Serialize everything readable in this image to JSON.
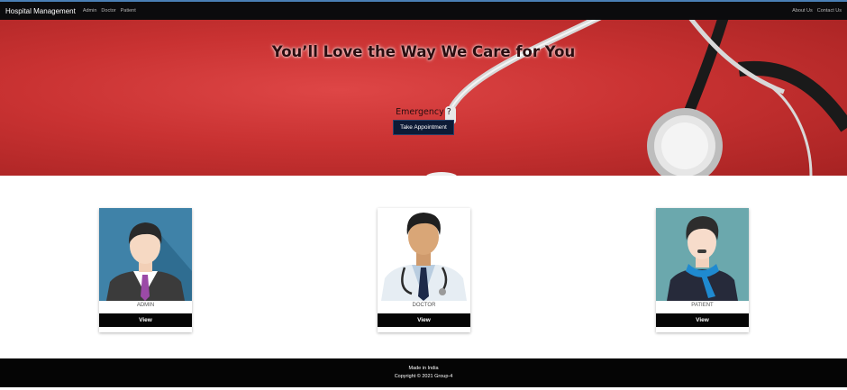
{
  "navbar": {
    "brand": "Hospital Management",
    "links": [
      "Admin",
      "Doctor",
      "Patient"
    ],
    "right_links": [
      "About Us",
      "Contact Us"
    ]
  },
  "hero": {
    "title": "You’ll Love the Way We Care for You",
    "emergency": "Emergency ?",
    "button": "Take Appointment",
    "background_image": "red background with stethoscope"
  },
  "cards": [
    {
      "label": "ADMIN",
      "button": "View",
      "image": "admin avatar illustration"
    },
    {
      "label": "DOCTOR",
      "button": "View",
      "image": "doctor avatar illustration"
    },
    {
      "label": "PATIENT",
      "button": "View",
      "image": "patient avatar illustration"
    }
  ],
  "footer": {
    "line1": "Made in India",
    "line2": "Copyright © 2021 Group-4"
  },
  "colors": {
    "navbar": "#0b0b0d",
    "hero_red": "#c93232",
    "button": "#050505",
    "appointment_button": "#0d1b36"
  }
}
